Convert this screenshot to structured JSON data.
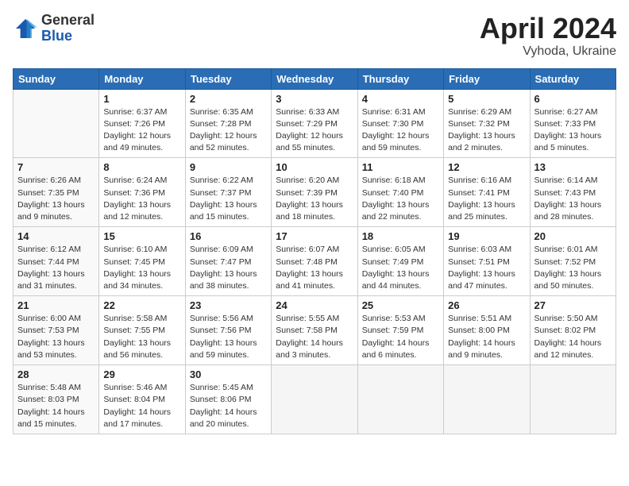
{
  "header": {
    "logo": {
      "general": "General",
      "blue": "Blue"
    },
    "title": "April 2024",
    "location": "Vyhoda, Ukraine"
  },
  "days_of_week": [
    "Sunday",
    "Monday",
    "Tuesday",
    "Wednesday",
    "Thursday",
    "Friday",
    "Saturday"
  ],
  "weeks": [
    [
      {
        "day": "",
        "info": ""
      },
      {
        "day": "1",
        "info": "Sunrise: 6:37 AM\nSunset: 7:26 PM\nDaylight: 12 hours\nand 49 minutes."
      },
      {
        "day": "2",
        "info": "Sunrise: 6:35 AM\nSunset: 7:28 PM\nDaylight: 12 hours\nand 52 minutes."
      },
      {
        "day": "3",
        "info": "Sunrise: 6:33 AM\nSunset: 7:29 PM\nDaylight: 12 hours\nand 55 minutes."
      },
      {
        "day": "4",
        "info": "Sunrise: 6:31 AM\nSunset: 7:30 PM\nDaylight: 12 hours\nand 59 minutes."
      },
      {
        "day": "5",
        "info": "Sunrise: 6:29 AM\nSunset: 7:32 PM\nDaylight: 13 hours\nand 2 minutes."
      },
      {
        "day": "6",
        "info": "Sunrise: 6:27 AM\nSunset: 7:33 PM\nDaylight: 13 hours\nand 5 minutes."
      }
    ],
    [
      {
        "day": "7",
        "info": "Sunrise: 6:26 AM\nSunset: 7:35 PM\nDaylight: 13 hours\nand 9 minutes."
      },
      {
        "day": "8",
        "info": "Sunrise: 6:24 AM\nSunset: 7:36 PM\nDaylight: 13 hours\nand 12 minutes."
      },
      {
        "day": "9",
        "info": "Sunrise: 6:22 AM\nSunset: 7:37 PM\nDaylight: 13 hours\nand 15 minutes."
      },
      {
        "day": "10",
        "info": "Sunrise: 6:20 AM\nSunset: 7:39 PM\nDaylight: 13 hours\nand 18 minutes."
      },
      {
        "day": "11",
        "info": "Sunrise: 6:18 AM\nSunset: 7:40 PM\nDaylight: 13 hours\nand 22 minutes."
      },
      {
        "day": "12",
        "info": "Sunrise: 6:16 AM\nSunset: 7:41 PM\nDaylight: 13 hours\nand 25 minutes."
      },
      {
        "day": "13",
        "info": "Sunrise: 6:14 AM\nSunset: 7:43 PM\nDaylight: 13 hours\nand 28 minutes."
      }
    ],
    [
      {
        "day": "14",
        "info": "Sunrise: 6:12 AM\nSunset: 7:44 PM\nDaylight: 13 hours\nand 31 minutes."
      },
      {
        "day": "15",
        "info": "Sunrise: 6:10 AM\nSunset: 7:45 PM\nDaylight: 13 hours\nand 34 minutes."
      },
      {
        "day": "16",
        "info": "Sunrise: 6:09 AM\nSunset: 7:47 PM\nDaylight: 13 hours\nand 38 minutes."
      },
      {
        "day": "17",
        "info": "Sunrise: 6:07 AM\nSunset: 7:48 PM\nDaylight: 13 hours\nand 41 minutes."
      },
      {
        "day": "18",
        "info": "Sunrise: 6:05 AM\nSunset: 7:49 PM\nDaylight: 13 hours\nand 44 minutes."
      },
      {
        "day": "19",
        "info": "Sunrise: 6:03 AM\nSunset: 7:51 PM\nDaylight: 13 hours\nand 47 minutes."
      },
      {
        "day": "20",
        "info": "Sunrise: 6:01 AM\nSunset: 7:52 PM\nDaylight: 13 hours\nand 50 minutes."
      }
    ],
    [
      {
        "day": "21",
        "info": "Sunrise: 6:00 AM\nSunset: 7:53 PM\nDaylight: 13 hours\nand 53 minutes."
      },
      {
        "day": "22",
        "info": "Sunrise: 5:58 AM\nSunset: 7:55 PM\nDaylight: 13 hours\nand 56 minutes."
      },
      {
        "day": "23",
        "info": "Sunrise: 5:56 AM\nSunset: 7:56 PM\nDaylight: 13 hours\nand 59 minutes."
      },
      {
        "day": "24",
        "info": "Sunrise: 5:55 AM\nSunset: 7:58 PM\nDaylight: 14 hours\nand 3 minutes."
      },
      {
        "day": "25",
        "info": "Sunrise: 5:53 AM\nSunset: 7:59 PM\nDaylight: 14 hours\nand 6 minutes."
      },
      {
        "day": "26",
        "info": "Sunrise: 5:51 AM\nSunset: 8:00 PM\nDaylight: 14 hours\nand 9 minutes."
      },
      {
        "day": "27",
        "info": "Sunrise: 5:50 AM\nSunset: 8:02 PM\nDaylight: 14 hours\nand 12 minutes."
      }
    ],
    [
      {
        "day": "28",
        "info": "Sunrise: 5:48 AM\nSunset: 8:03 PM\nDaylight: 14 hours\nand 15 minutes."
      },
      {
        "day": "29",
        "info": "Sunrise: 5:46 AM\nSunset: 8:04 PM\nDaylight: 14 hours\nand 17 minutes."
      },
      {
        "day": "30",
        "info": "Sunrise: 5:45 AM\nSunset: 8:06 PM\nDaylight: 14 hours\nand 20 minutes."
      },
      {
        "day": "",
        "info": ""
      },
      {
        "day": "",
        "info": ""
      },
      {
        "day": "",
        "info": ""
      },
      {
        "day": "",
        "info": ""
      }
    ]
  ]
}
